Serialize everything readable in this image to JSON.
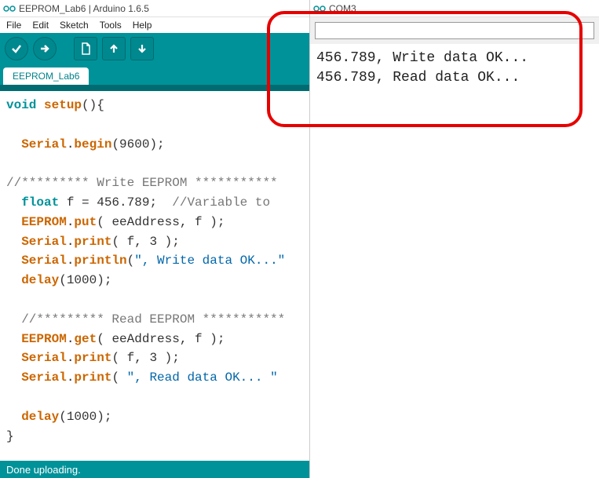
{
  "ide": {
    "title": "EEPROM_Lab6 | Arduino 1.6.5",
    "menu": [
      "File",
      "Edit",
      "Sketch",
      "Tools",
      "Help"
    ],
    "tab": "EEPROM_Lab6",
    "status": "Done uploading.",
    "code": {
      "l1_kw": "void",
      "l1_fn": "setup",
      "l1_rest": "(){",
      "l3_a": "Serial",
      "l3_b": "begin",
      "l3_c": "(9600);",
      "l5": "//********* Write EEPROM ***********",
      "l6_a": "float",
      "l6_b": " f = 456.789;  ",
      "l6_c": "//Variable to ",
      "l7_a": "EEPROM",
      "l7_b": "put",
      "l7_c": "( eeAddress, f );",
      "l8_a": "Serial",
      "l8_b": "print",
      "l8_c": "( f, 3 );",
      "l9_a": "Serial",
      "l9_b": "println",
      "l9_c": "(",
      "l9_str": "\", Write data OK...\"",
      "l10_a": "delay",
      "l10_b": "(1000);",
      "l12": "  //********* Read EEPROM ***********",
      "l13_a": "EEPROM",
      "l13_b": "get",
      "l13_c": "( eeAddress, f );",
      "l14_a": "Serial",
      "l14_b": "print",
      "l14_c": "( f, 3 );",
      "l15_a": "Serial",
      "l15_b": "print",
      "l15_c": "( ",
      "l15_str": "\", Read data OK... \"",
      "l17_a": "delay",
      "l17_b": "(1000);",
      "l18": "}"
    }
  },
  "serial": {
    "title": "COM3",
    "input_placeholder": "",
    "lines": [
      "456.789, Write data OK...",
      "456.789, Read data OK..."
    ]
  }
}
